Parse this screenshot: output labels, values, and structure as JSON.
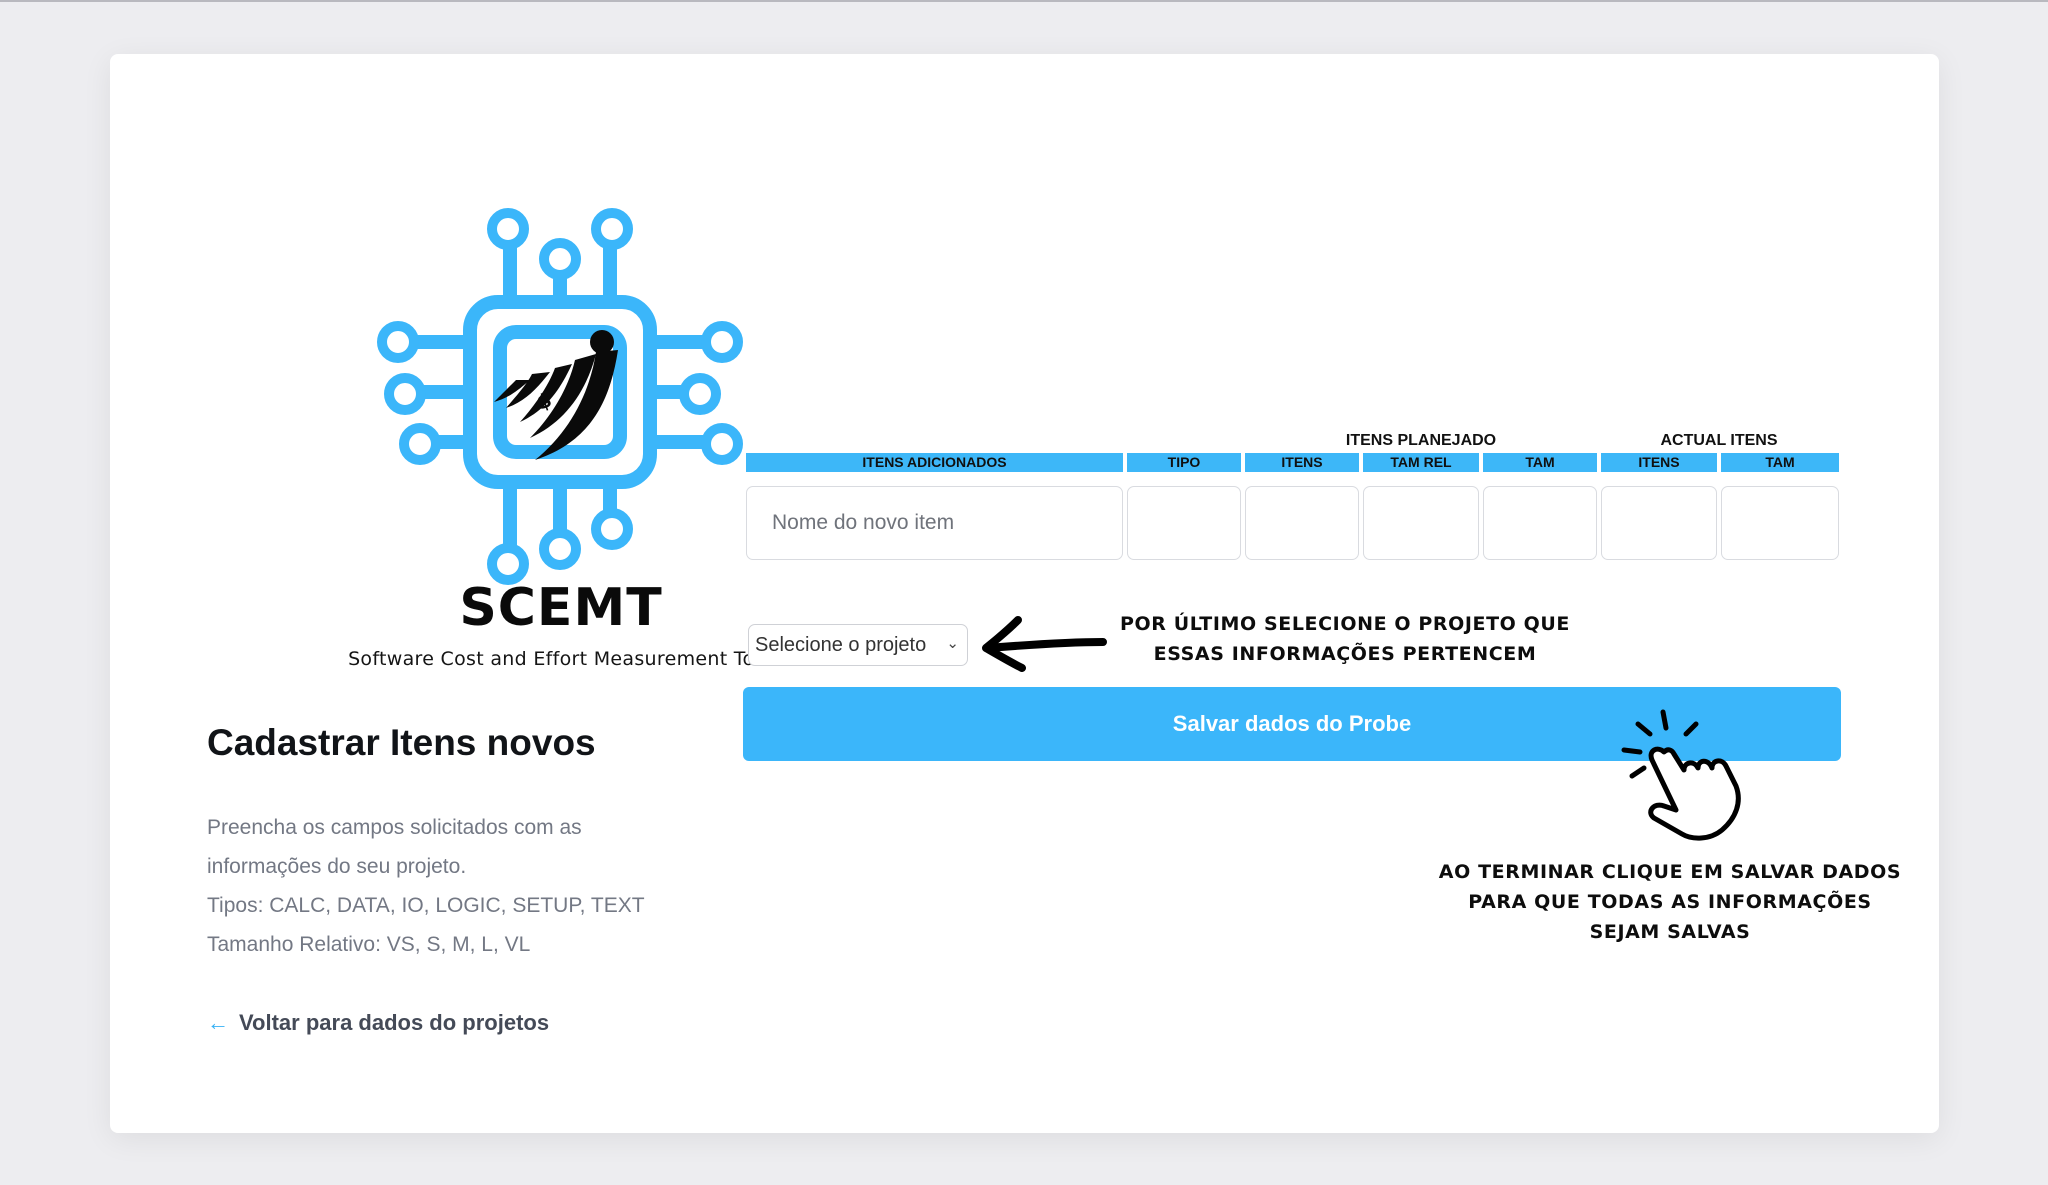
{
  "brand": {
    "name": "SCEMT",
    "subtitle": "Software Cost and Effort Measurement Tool",
    "accent_color": "#3bb6fa"
  },
  "page": {
    "title": "Cadastrar Itens novos",
    "instructions": [
      "Preencha os campos solicitados com as",
      "informações do seu projeto.",
      "Tipos: CALC, DATA, IO, LOGIC, SETUP, TEXT",
      "Tamanho Relativo: VS, S, M, L, VL"
    ],
    "back_link": "Voltar para dados do projetos",
    "back_icon": "arrow-left-icon"
  },
  "table": {
    "group_planned": "ITENS PLANEJADO",
    "group_actual": "ACTUAL ITENS",
    "columns": [
      "ITENS ADICIONADOS",
      "TIPO",
      "ITENS",
      "TAM REL",
      "TAM",
      "ITENS",
      "TAM"
    ],
    "name_placeholder": "Nome do novo item"
  },
  "project_select": {
    "selected": "Selecione o projeto"
  },
  "notes": {
    "select_hint_line1": "POR ÚLTIMO SELECIONE O PROJETO QUE",
    "select_hint_line2": "ESSAS INFORMAÇÕES PERTENCEM",
    "save_hint_line1": "AO TERMINAR CLIQUE EM SALVAR DADOS",
    "save_hint_line2": "PARA QUE TODAS AS INFORMAÇÕES",
    "save_hint_line3": "SEJAM SALVAS"
  },
  "save_button": {
    "label": "Salvar dados do Probe"
  }
}
